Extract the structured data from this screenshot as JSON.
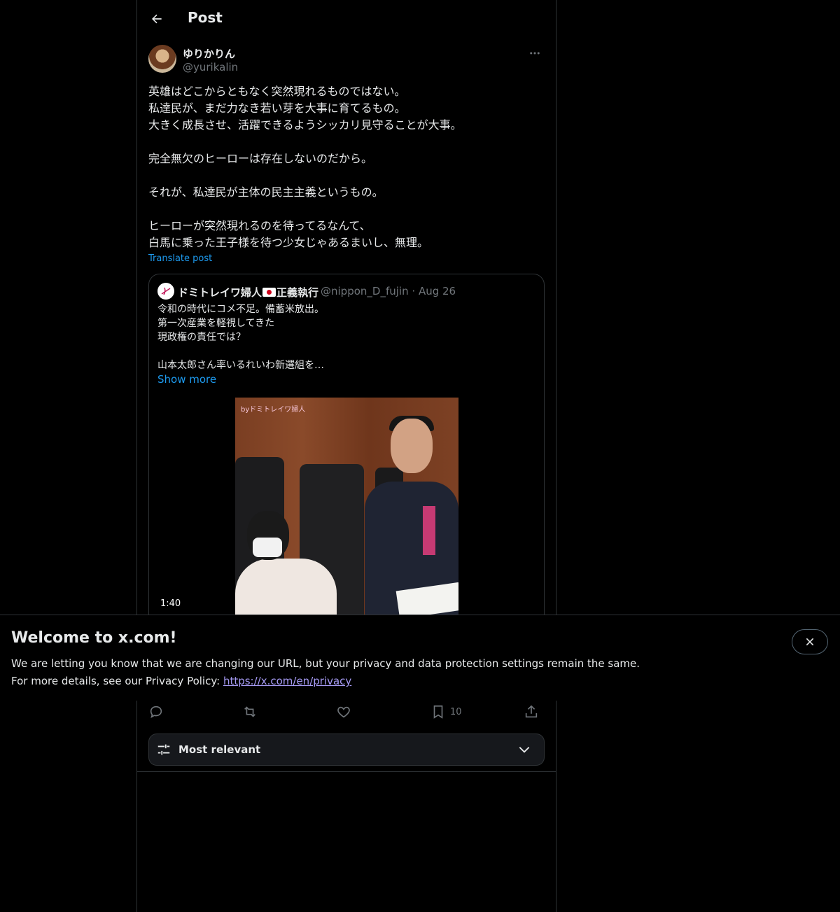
{
  "header": {
    "title": "Post"
  },
  "post": {
    "author": {
      "display_name": "ゆりかりん",
      "handle": "@yurikalin"
    },
    "lines": [
      "英雄はどこからともなく突然現れるものではない。",
      "私達民が、まだ力なき若い芽を大事に育てるもの。",
      "大きく成長させ、活躍できるようシッカリ見守ることが大事。",
      "完全無欠のヒーローは存在しないのだから。",
      "それが、私達民が主体の民主主義というもの。",
      "ヒーローが突然現れるのを待ってるなんて、",
      "白馬に乗った王子様を待つ少女じゃあるまいし、無理。"
    ],
    "translate_label": "Translate post"
  },
  "quote": {
    "name_part1": "ドミトレイワ婦人",
    "name_part2": "正義執行",
    "handle": "@nippon_D_fujin",
    "separator": "·",
    "date": "Aug 26",
    "lines": [
      "令和の時代にコメ不足。備蓄米放出。",
      "第一次産業を軽視してきた",
      "現政権の責任では？",
      "山本太郎さん率いるれいわ新選組を…"
    ],
    "show_more": "Show more",
    "video": {
      "watermark": "byドミトレイワ婦人",
      "duration": "1:40"
    }
  },
  "actions": {
    "bookmark_count": "10"
  },
  "sort": {
    "label": "Most relevant"
  },
  "banner": {
    "title": "Welcome to x.com!",
    "line1": "We are letting you know that we are changing our URL, but your privacy and data protection settings remain the same.",
    "line2_prefix": "For more details, see our Privacy Policy: ",
    "link": "https://x.com/en/privacy"
  },
  "colors": {
    "accent": "#1d9bf0",
    "muted": "#71767b",
    "text": "#e7e9ea",
    "link_banner": "#a79cf6"
  }
}
